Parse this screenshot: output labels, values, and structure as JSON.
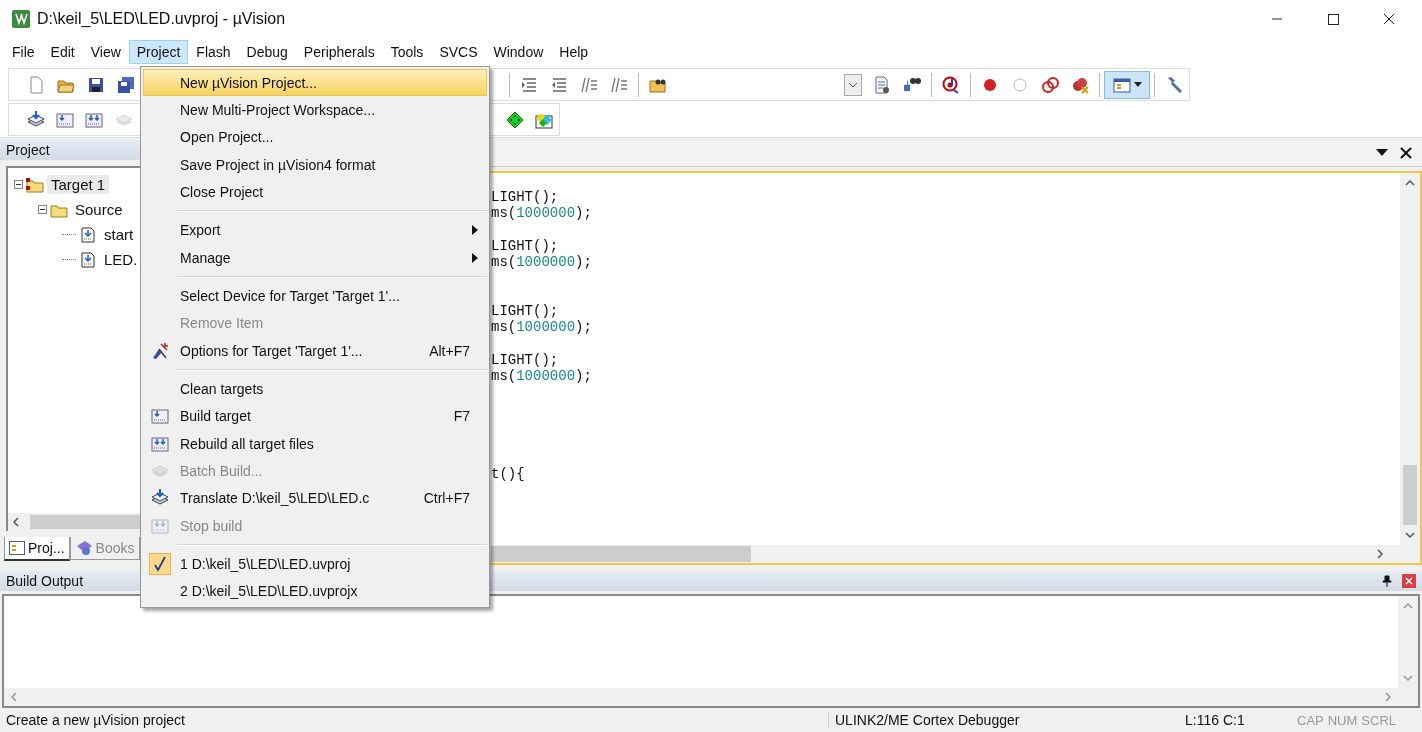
{
  "window": {
    "title": "D:\\keil_5\\LED\\LED.uvproj - µVision"
  },
  "menu_bar": [
    {
      "label": "File",
      "selected": false
    },
    {
      "label": "Edit",
      "selected": false
    },
    {
      "label": "View",
      "selected": false
    },
    {
      "label": "Project",
      "selected": true
    },
    {
      "label": "Flash",
      "selected": false
    },
    {
      "label": "Debug",
      "selected": false
    },
    {
      "label": "Peripherals",
      "selected": false
    },
    {
      "label": "Tools",
      "selected": false
    },
    {
      "label": "SVCS",
      "selected": false
    },
    {
      "label": "Window",
      "selected": false
    },
    {
      "label": "Help",
      "selected": false
    }
  ],
  "toolbar": {
    "window_button_pressed": true
  },
  "project_menu": [
    {
      "kind": "command",
      "label": "New µVision Project...",
      "selected": true,
      "disabled": false,
      "checked": false,
      "submenu": false
    },
    {
      "kind": "command",
      "label": "New Multi-Project Workspace...",
      "selected": false,
      "disabled": false,
      "checked": false,
      "submenu": false
    },
    {
      "kind": "command",
      "label": "Open Project...",
      "selected": false,
      "disabled": false,
      "checked": false,
      "submenu": false
    },
    {
      "kind": "command",
      "label": "Save Project in µVision4 format",
      "selected": false,
      "disabled": false,
      "checked": false,
      "submenu": false
    },
    {
      "kind": "command",
      "label": "Close Project",
      "selected": false,
      "disabled": false,
      "checked": false,
      "submenu": false
    },
    {
      "kind": "separator"
    },
    {
      "kind": "command",
      "label": "Export",
      "selected": false,
      "disabled": false,
      "checked": false,
      "submenu": true
    },
    {
      "kind": "command",
      "label": "Manage",
      "selected": false,
      "disabled": false,
      "checked": false,
      "submenu": true
    },
    {
      "kind": "separator"
    },
    {
      "kind": "command",
      "label": "Select Device for Target 'Target 1'...",
      "selected": false,
      "disabled": false,
      "checked": false,
      "submenu": false
    },
    {
      "kind": "command",
      "label": "Remove Item",
      "selected": false,
      "disabled": true,
      "checked": false,
      "submenu": false
    },
    {
      "kind": "options",
      "label": "Options for Target 'Target 1'...",
      "shortcut": "Alt+F7",
      "selected": false,
      "disabled": false,
      "checked": false,
      "submenu": false
    },
    {
      "kind": "separator"
    },
    {
      "kind": "command",
      "label": "Clean targets",
      "selected": false,
      "disabled": false,
      "checked": false,
      "submenu": false
    },
    {
      "kind": "build",
      "label": "Build target",
      "shortcut": "F7",
      "selected": false,
      "disabled": false,
      "checked": false,
      "submenu": false
    },
    {
      "kind": "rebuild",
      "label": "Rebuild all target files",
      "selected": false,
      "disabled": false,
      "checked": false,
      "submenu": false
    },
    {
      "kind": "batch",
      "label": "Batch Build...",
      "selected": false,
      "disabled": true,
      "checked": false,
      "submenu": false
    },
    {
      "kind": "translate",
      "label": "Translate D:\\keil_5\\LED\\LED.c",
      "shortcut": "Ctrl+F7",
      "selected": false,
      "disabled": false,
      "checked": false,
      "submenu": false
    },
    {
      "kind": "stop",
      "label": "Stop build",
      "selected": false,
      "disabled": true,
      "checked": false,
      "submenu": false
    },
    {
      "kind": "separator"
    },
    {
      "kind": "command",
      "label": "1 D:\\keil_5\\LED\\LED.uvproj",
      "selected": false,
      "disabled": false,
      "checked": true,
      "submenu": false
    },
    {
      "kind": "command",
      "label": "2 D:\\keil_5\\LED\\LED.uvprojx",
      "selected": false,
      "disabled": false,
      "checked": false,
      "submenu": false
    }
  ],
  "project_panel": {
    "title": "Project",
    "tree": [
      {
        "label": "Target 1",
        "kind": "target",
        "selected": true,
        "expanded": true,
        "children": [
          {
            "label": "Source",
            "kind": "group",
            "selected": false,
            "expanded": true,
            "children": [
              {
                "label": "start",
                "kind": "file",
                "selected": false
              },
              {
                "label": "LED.",
                "kind": "file",
                "selected": false
              }
            ]
          }
        ]
      }
    ],
    "tabs": [
      {
        "label": "Proj...",
        "selected": true
      },
      {
        "label": "Books",
        "selected": false
      }
    ]
  },
  "editor": {
    "lines": [
      {
        "kind": "code",
        "tokens": [
          {
            "kind": "plain",
            "text": "LIGHT();"
          }
        ]
      },
      {
        "kind": "code",
        "tokens": [
          {
            "kind": "plain",
            "text": "ms("
          },
          {
            "kind": "number",
            "text": "1000000"
          },
          {
            "kind": "plain",
            "text": ");"
          }
        ]
      },
      {
        "kind": "blank"
      },
      {
        "kind": "code",
        "tokens": [
          {
            "kind": "plain",
            "text": "LIGHT();"
          }
        ]
      },
      {
        "kind": "code",
        "tokens": [
          {
            "kind": "plain",
            "text": "ms("
          },
          {
            "kind": "number",
            "text": "1000000"
          },
          {
            "kind": "plain",
            "text": ");"
          }
        ]
      },
      {
        "kind": "blank"
      },
      {
        "kind": "blank"
      },
      {
        "kind": "code",
        "tokens": [
          {
            "kind": "plain",
            "text": "LIGHT();"
          }
        ]
      },
      {
        "kind": "code",
        "tokens": [
          {
            "kind": "plain",
            "text": "ms("
          },
          {
            "kind": "number",
            "text": "1000000"
          },
          {
            "kind": "plain",
            "text": ");"
          }
        ]
      },
      {
        "kind": "blank"
      },
      {
        "kind": "code",
        "tokens": [
          {
            "kind": "plain",
            "text": "LIGHT();"
          }
        ]
      },
      {
        "kind": "code",
        "tokens": [
          {
            "kind": "plain",
            "text": "ms("
          },
          {
            "kind": "number",
            "text": "1000000"
          },
          {
            "kind": "plain",
            "text": ");"
          }
        ]
      },
      {
        "kind": "blank"
      },
      {
        "kind": "blank"
      },
      {
        "kind": "blank"
      },
      {
        "kind": "blank"
      },
      {
        "kind": "blank"
      },
      {
        "kind": "code",
        "tokens": [
          {
            "kind": "plain",
            "text": "t(){"
          }
        ]
      }
    ]
  },
  "build_output": {
    "title": "Build Output"
  },
  "status_bar": {
    "message": "Create a new µVision project",
    "debugger": "ULINK2/ME Cortex Debugger",
    "position": "L:116 C:1",
    "indicators": [
      "CAP",
      "NUM",
      "SCRL"
    ]
  }
}
